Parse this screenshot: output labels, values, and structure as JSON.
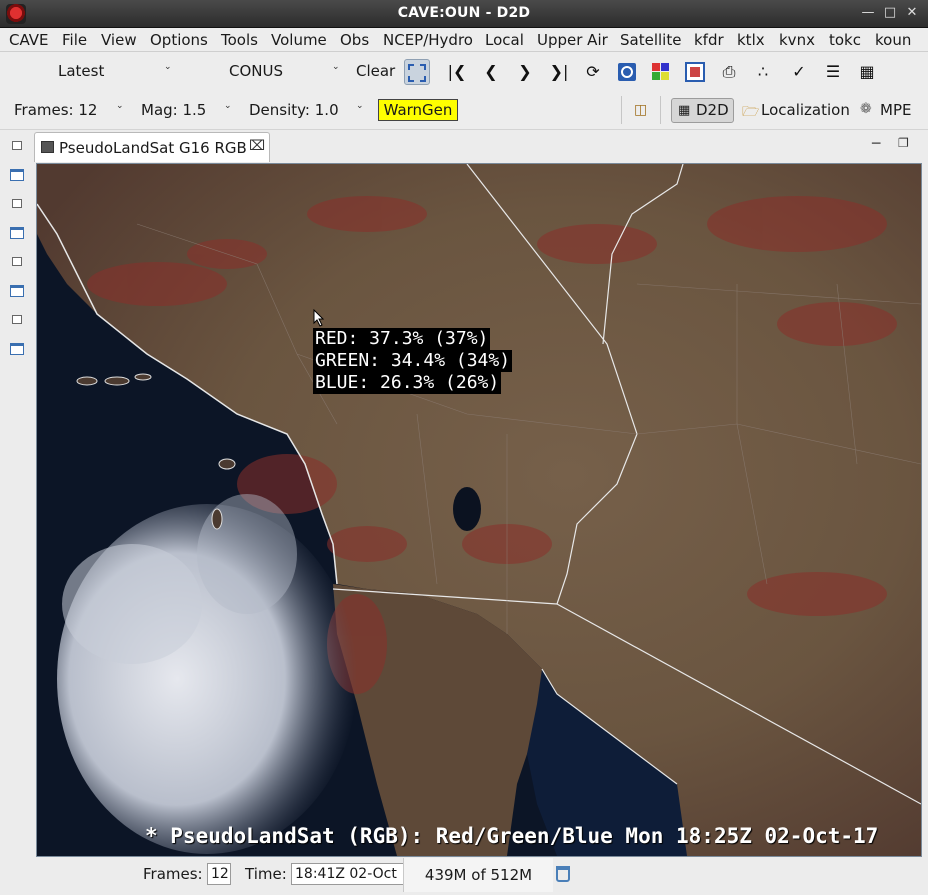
{
  "window": {
    "title": "CAVE:OUN - D2D"
  },
  "menu": [
    "CAVE",
    "File",
    "View",
    "Options",
    "Tools",
    "Volume",
    "Obs",
    "NCEP/Hydro",
    "Local",
    "Upper Air",
    "Satellite",
    "kfdr",
    "ktlx",
    "kvnx",
    "tokc",
    "koun"
  ],
  "toolbar": {
    "time_combo": "Latest",
    "scale_combo": "CONUS",
    "clear_label": "Clear"
  },
  "toolbar2": {
    "frames_label": "Frames: 12",
    "mag_label": "Mag: 1.5",
    "density_label": "Density: 1.0",
    "warngen_label": "WarnGen",
    "perspective_d2d": "D2D",
    "perspective_localization": "Localization",
    "perspective_mpe": "MPE"
  },
  "tab": {
    "label": "PseudoLandSat G16 RGB"
  },
  "readout": {
    "red": "RED: 37.3% (37%)",
    "green": "GREEN: 34.4% (34%)",
    "blue": "BLUE: 26.3% (26%)"
  },
  "caption": "* PseudoLandSat (RGB): Red/Green/Blue Mon 18:25Z 02-Oct-17",
  "status": {
    "frames_label": "Frames:",
    "frames_value": "12",
    "time_label": "Time:",
    "time_value": "18:41Z 02-Oct",
    "memory": "439M of 512M"
  },
  "colors": {
    "warngen": "#ffff00",
    "land": "#6e5a44",
    "ocean": "#0c1526"
  }
}
